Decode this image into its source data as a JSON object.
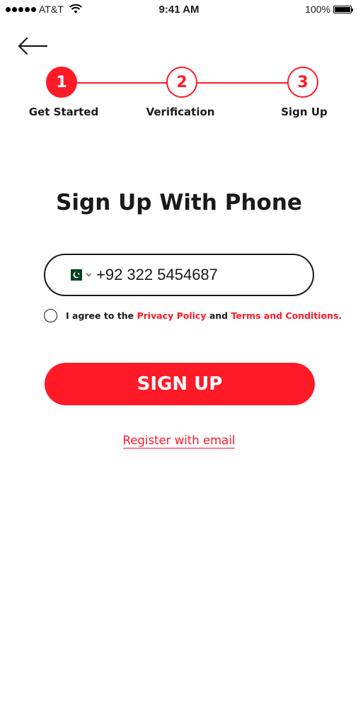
{
  "status_bar": {
    "carrier": "AT&T",
    "time": "9:41 AM",
    "battery": "100%",
    "battery_level": 1.0
  },
  "stepper": {
    "current_step": 1,
    "steps": [
      {
        "number": "1",
        "label": "Get Started"
      },
      {
        "number": "2",
        "label": "Verification"
      },
      {
        "number": "3",
        "label": "Sign Up"
      }
    ]
  },
  "title": "Sign Up With Phone",
  "phone": {
    "country_flag_icon": "pakistan-flag-icon",
    "value": "+92 322 5454687"
  },
  "agreement": {
    "prefix": "I agree to the ",
    "privacy_link": "Privacy Policy",
    "middle": " and ",
    "terms_link": "Terms and Conditions."
  },
  "signup_button": "SIGN UP",
  "register_email_link": "Register with email",
  "colors": {
    "accent": "#ff1a27",
    "text": "#1a1a1a",
    "background": "#ffffff"
  }
}
